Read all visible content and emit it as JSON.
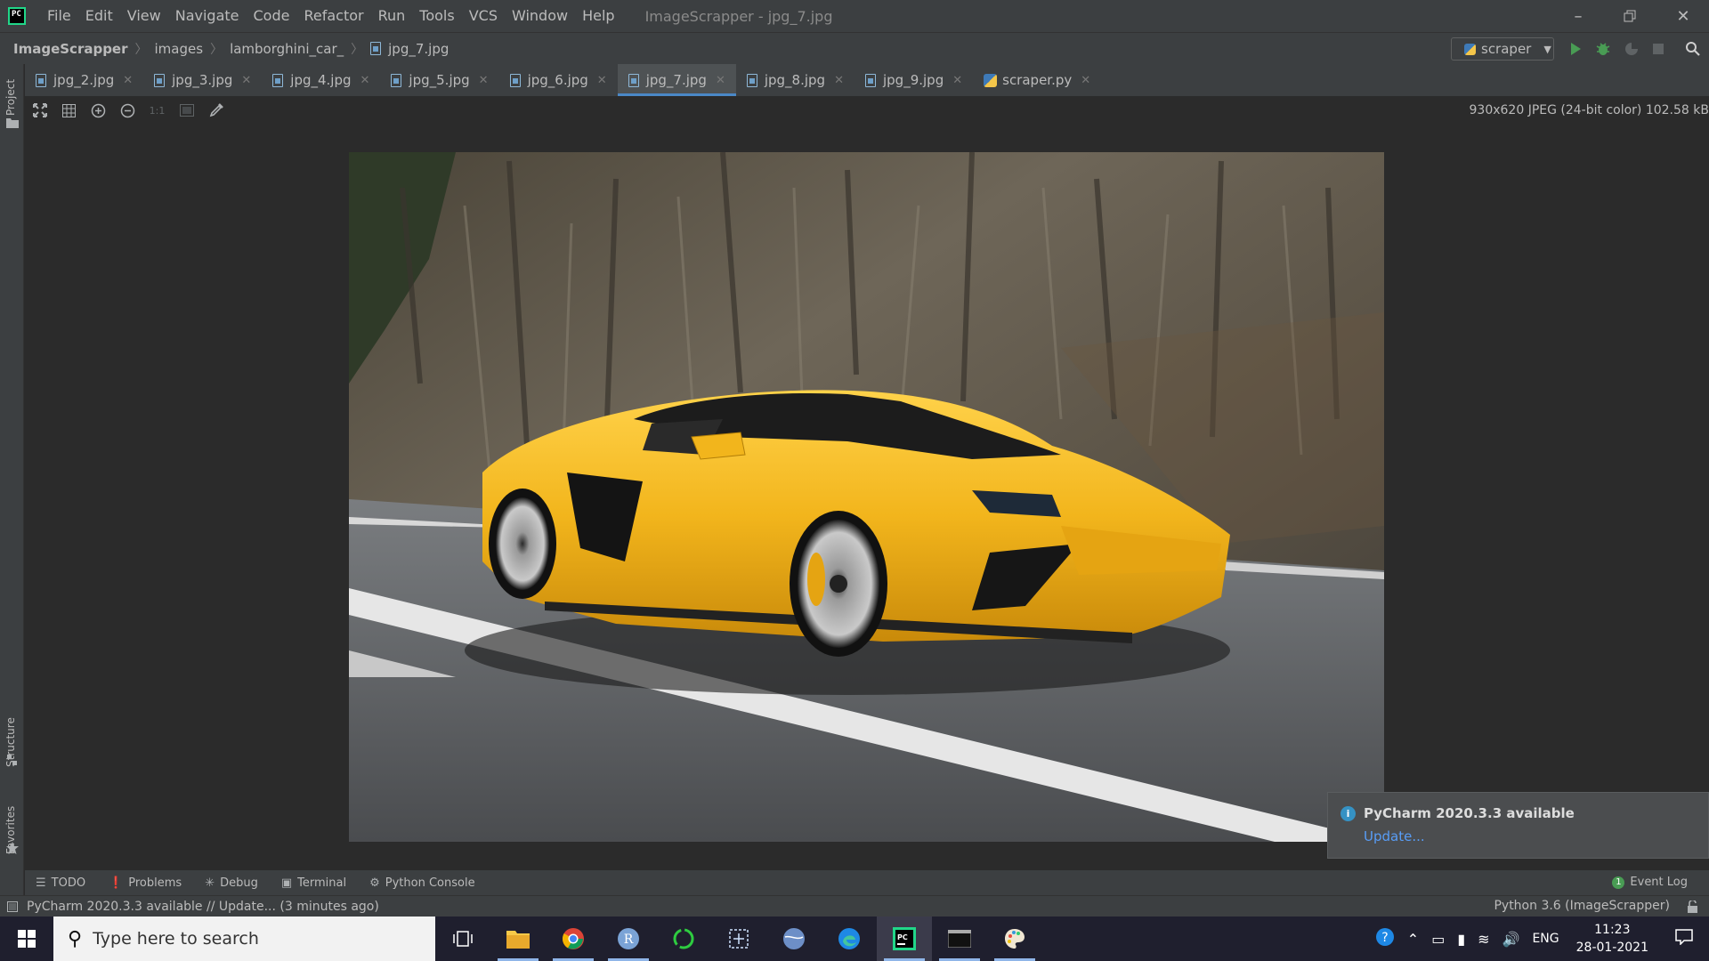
{
  "window": {
    "title": "ImageScrapper - jpg_7.jpg",
    "menu": [
      "File",
      "Edit",
      "View",
      "Navigate",
      "Code",
      "Refactor",
      "Run",
      "Tools",
      "VCS",
      "Window",
      "Help"
    ]
  },
  "breadcrumb": [
    "ImageScrapper",
    "images",
    "lamborghini_car_",
    "jpg_7.jpg"
  ],
  "run_config": "scraper",
  "left_stripe": {
    "project": "Project",
    "structure": "Structure",
    "favorites": "Favorites"
  },
  "tabs": [
    {
      "label": "jpg_2.jpg",
      "active": false
    },
    {
      "label": "jpg_3.jpg",
      "active": false
    },
    {
      "label": "jpg_4.jpg",
      "active": false
    },
    {
      "label": "jpg_5.jpg",
      "active": false
    },
    {
      "label": "jpg_6.jpg",
      "active": false
    },
    {
      "label": "jpg_7.jpg",
      "active": true
    },
    {
      "label": "jpg_8.jpg",
      "active": false
    },
    {
      "label": "jpg_9.jpg",
      "active": false
    },
    {
      "label": "scraper.py",
      "active": false
    }
  ],
  "image_toolbar": {
    "one_to_one": "1:1",
    "info": "930x620 JPEG (24-bit color) 102.58 kB"
  },
  "notification": {
    "title": "PyCharm 2020.3.3 available",
    "link": "Update..."
  },
  "tool_windows": [
    "TODO",
    "Problems",
    "Debug",
    "Terminal",
    "Python Console"
  ],
  "event_log": {
    "count": "1",
    "label": "Event Log"
  },
  "status": {
    "message": "PyCharm 2020.3.3 available // Update... (3 minutes ago)",
    "interpreter": "Python 3.6 (ImageScrapper)"
  },
  "taskbar": {
    "search_placeholder": "Type here to search",
    "language": "ENG",
    "time": "11:23",
    "date": "28-01-2021"
  },
  "colors": {
    "accent": "#4a88c7",
    "car": "#f2b51c",
    "link": "#589df6"
  }
}
